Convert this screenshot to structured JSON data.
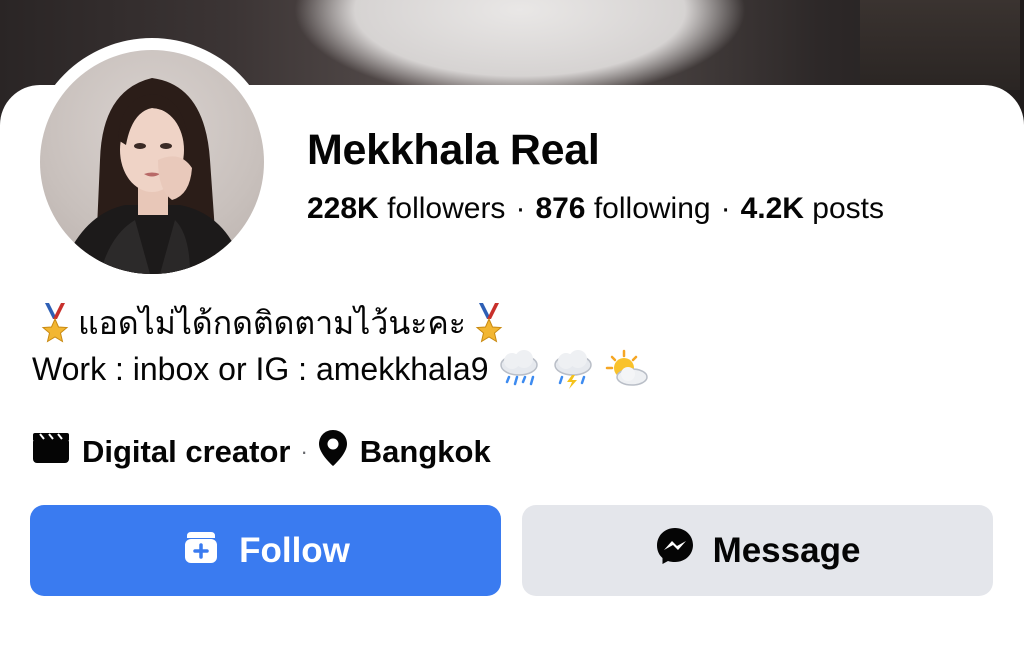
{
  "profile": {
    "name": "Mekkhala Real",
    "followers_count": "228K",
    "followers_label": "followers",
    "following_count": "876",
    "following_label": "following",
    "posts_count": "4.2K",
    "posts_label": "posts",
    "separator": "·"
  },
  "bio": {
    "line1": "แอดไม่ได้กดติดตามไว้นะคะ",
    "line2": "Work : inbox or IG : amekkhala9"
  },
  "meta": {
    "category": "Digital creator",
    "separator": "·",
    "location": "Bangkok"
  },
  "actions": {
    "follow_label": "Follow",
    "message_label": "Message"
  },
  "colors": {
    "primary_blue": "#3a7bf0",
    "secondary_gray": "#e4e6eb",
    "text": "#050505"
  },
  "icons": {
    "medal": "medal-icon",
    "rain": "rain-cloud-icon",
    "storm": "thunderstorm-cloud-icon",
    "sun_cloud": "sun-behind-cloud-icon",
    "category": "clapperboard-icon",
    "location": "location-pin-icon",
    "follow": "add-friend-icon",
    "message": "messenger-icon"
  }
}
